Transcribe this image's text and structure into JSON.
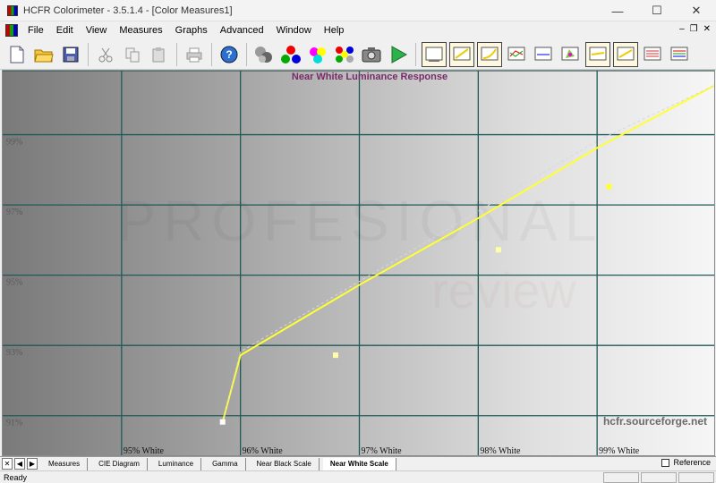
{
  "window": {
    "title": "HCFR Colorimeter - 3.5.1.4 - [Color Measures1]",
    "minimize": "—",
    "maximize": "☐",
    "close": "✕"
  },
  "menu": {
    "items": [
      "File",
      "Edit",
      "View",
      "Measures",
      "Graphs",
      "Advanced",
      "Window",
      "Help"
    ],
    "mdi_min": "–",
    "mdi_restore": "❐",
    "mdi_close": "✕"
  },
  "toolbar": {
    "icons": [
      "new-document-icon",
      "open-folder-icon",
      "save-icon",
      "cut-icon",
      "copy-icon",
      "paste-icon",
      "print-icon",
      "help-icon",
      "sensor-icon",
      "rgb-balls-icon",
      "color-balls-icon",
      "multi-balls-icon",
      "camera-icon",
      "play-icon",
      "graph-window-icon",
      "graph-rising-icon",
      "graph-curve-icon",
      "graph-multiline-icon",
      "graph-flat-icon",
      "cie-diagram-icon",
      "graph-yellow-icon",
      "graph-yellow-rising-icon",
      "graph-rgb-icon",
      "graph-rgb-alt-icon"
    ]
  },
  "chart_data": {
    "type": "line",
    "title": "Near White Luminance Response",
    "watermark": "hcfr.sourceforge.net",
    "categories": [
      "95% White",
      "96% White",
      "97% White",
      "98% White",
      "99% White"
    ],
    "x": [
      94,
      95,
      96,
      97,
      98,
      99,
      100
    ],
    "xlim": [
      94,
      100
    ],
    "ylim": [
      90,
      101
    ],
    "y_ticks": [
      91,
      93,
      95,
      97,
      99
    ],
    "y_tick_labels": [
      "91%",
      "93%",
      "95%",
      "97%",
      "99%"
    ],
    "grid": true,
    "series": [
      {
        "values": [
          null,
          91.0,
          92.9,
          94.9,
          96.8,
          98.8,
          100.6
        ],
        "color": "#ffff33",
        "style": "solid"
      },
      {
        "values": [
          null,
          91.0,
          93.0,
          95.0,
          97.0,
          99.0,
          100.6
        ],
        "color": "#d8d8d8",
        "style": "dashed"
      }
    ],
    "markers": [
      {
        "x": 95.85,
        "y": 91.0,
        "color": "#ffffff"
      },
      {
        "x": 96.8,
        "y": 92.9,
        "color": "#ffffaa"
      },
      {
        "x": 98.17,
        "y": 95.9,
        "color": "#ffffaa"
      },
      {
        "x": 99.1,
        "y": 97.7,
        "color": "#ffff33"
      }
    ]
  },
  "tabs": {
    "nav": [
      "✕",
      "◀",
      "▶"
    ],
    "items": [
      "Measures",
      "CIE Diagram",
      "Luminance",
      "Gamma",
      "Near Black Scale",
      "Near White Scale"
    ],
    "active": "Near White Scale",
    "reference_label": "Reference"
  },
  "status": {
    "text": "Ready"
  }
}
